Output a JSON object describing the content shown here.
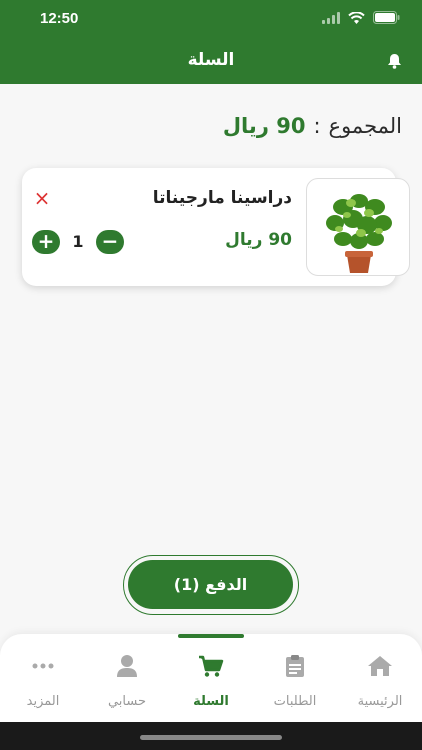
{
  "status_bar": {
    "time": "12:50"
  },
  "header": {
    "title": "السلة"
  },
  "cart": {
    "total_label": "المجموع",
    "total_separator": ":",
    "total_value": "90 ريال"
  },
  "items": [
    {
      "name": "دراسينا مارجيناتا",
      "price": "90 ريال",
      "quantity": "1",
      "plus": "+",
      "minus": "−",
      "remove": "×"
    }
  ],
  "checkout": {
    "label": "الدفع (1)"
  },
  "tabs": [
    {
      "label": "الرئيسية",
      "icon": "home-icon",
      "active": false
    },
    {
      "label": "الطلبات",
      "icon": "clipboard-icon",
      "active": false
    },
    {
      "label": "السلة",
      "icon": "cart-icon",
      "active": true
    },
    {
      "label": "حسابي",
      "icon": "user-icon",
      "active": false
    },
    {
      "label": "المزيد",
      "icon": "more-icon",
      "active": false
    }
  ],
  "colors": {
    "primary": "#2f7a2f",
    "remove": "#dd3333",
    "inactive": "#999999"
  }
}
